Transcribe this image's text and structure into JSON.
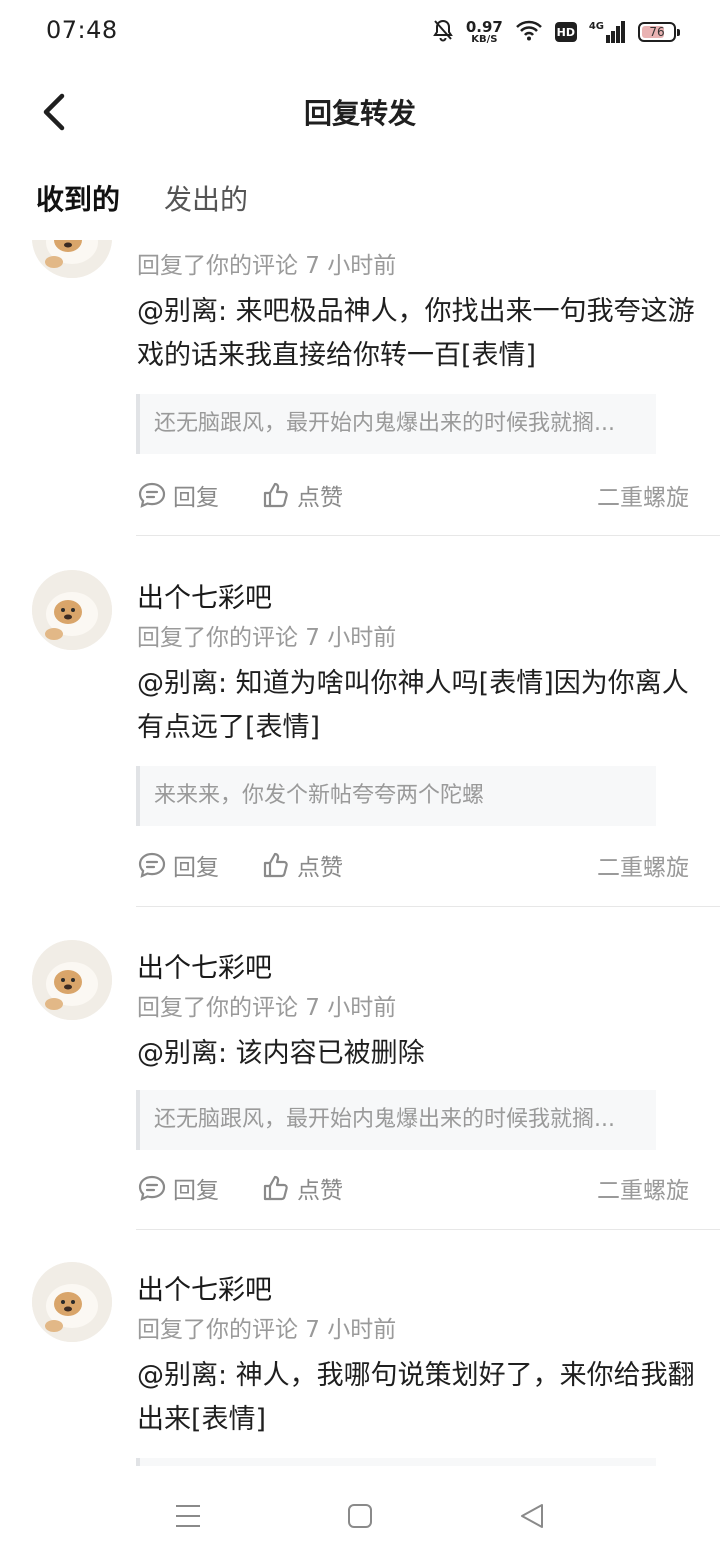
{
  "status_bar": {
    "time": "07:48",
    "net_speed_value": "0.97",
    "net_speed_unit": "KB/S",
    "hd_label": "HD",
    "network_type": "4G",
    "battery_level": "76",
    "battery_fraction": 0.76,
    "icons": [
      "bell-off-icon",
      "wifi-icon",
      "hd-icon",
      "signal-icon",
      "battery-icon"
    ]
  },
  "header": {
    "title": "回复转发",
    "back_icon": "chevron-left-icon"
  },
  "tabs": [
    {
      "label": "收到的",
      "active": true
    },
    {
      "label": "发出的",
      "active": false
    }
  ],
  "accent_color": "#25c8c0",
  "comments": [
    {
      "username": "",
      "meta": "回复了你的评论 7 小时前",
      "content": "@别离: 来吧极品神人，你找出来一句我夸这游戏的话来我直接给你转一百[表情]",
      "quote": "还无脑跟风，最开始内鬼爆出来的时候我就搁...",
      "reply_label": "回复",
      "like_label": "点赞",
      "author": "二重螺旋"
    },
    {
      "username": "出个七彩吧",
      "meta": "回复了你的评论 7 小时前",
      "content": "@别离: 知道为啥叫你神人吗[表情]因为你离人有点远了[表情]",
      "quote": "来来来，你发个新帖夸夸两个陀螺",
      "reply_label": "回复",
      "like_label": "点赞",
      "author": "二重螺旋"
    },
    {
      "username": "出个七彩吧",
      "meta": "回复了你的评论 7 小时前",
      "content": "@别离: 该内容已被删除",
      "quote": "还无脑跟风，最开始内鬼爆出来的时候我就搁...",
      "reply_label": "回复",
      "like_label": "点赞",
      "author": "二重螺旋"
    },
    {
      "username": "出个七彩吧",
      "meta": "回复了你的评论 7 小时前",
      "content": "@别离: 神人，我哪句说策划好了，来你给我翻出来[表情]",
      "quote": "",
      "reply_label": "回复",
      "like_label": "点赞",
      "author": ""
    }
  ],
  "nav_bar": {
    "icons": [
      "menu-icon",
      "home-square-icon",
      "back-triangle-icon"
    ]
  }
}
